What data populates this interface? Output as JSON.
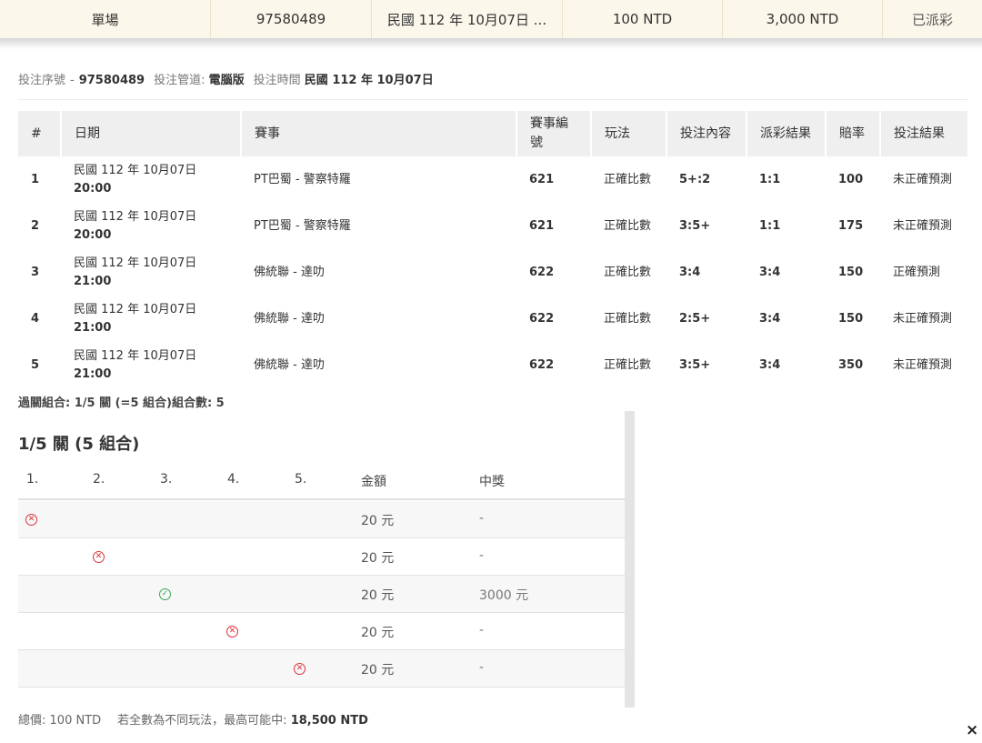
{
  "summary_row": {
    "type": "單場",
    "serial": "97580489",
    "date": "民國 112 年 10月07日 ...",
    "stake": "100 NTD",
    "payout": "3,000 NTD",
    "status": "已派彩"
  },
  "info": {
    "serial_label": "投注序號",
    "serial_value": "97580489",
    "channel_label": "投注管道:",
    "channel_value": "電腦版",
    "time_label": "投注時間",
    "time_value": "民國 112 年 10月07日"
  },
  "table": {
    "headers": [
      "#",
      "日期",
      "賽事",
      "賽事編號",
      "玩法",
      "投注內容",
      "派彩結果",
      "賠率",
      "投注結果"
    ],
    "rows": [
      {
        "no": "1",
        "date": "民國 112 年 10月07日",
        "time": "20:00",
        "event": "PT巴蜀 - 警察特羅",
        "event_no": "621",
        "play": "正確比數",
        "bet": "5+:2",
        "result": "1:1",
        "odds": "100",
        "outcome": "未正確預測"
      },
      {
        "no": "2",
        "date": "民國 112 年 10月07日",
        "time": "20:00",
        "event": "PT巴蜀 - 警察特羅",
        "event_no": "621",
        "play": "正確比數",
        "bet": "3:5+",
        "result": "1:1",
        "odds": "175",
        "outcome": "未正確預測"
      },
      {
        "no": "3",
        "date": "民國 112 年 10月07日",
        "time": "21:00",
        "event": "佛統聯 - 達叻",
        "event_no": "622",
        "play": "正確比數",
        "bet": "3:4",
        "result": "3:4",
        "odds": "150",
        "outcome": "正確預測"
      },
      {
        "no": "4",
        "date": "民國 112 年 10月07日",
        "time": "21:00",
        "event": "佛統聯 - 達叻",
        "event_no": "622",
        "play": "正確比數",
        "bet": "2:5+",
        "result": "3:4",
        "odds": "150",
        "outcome": "未正確預測"
      },
      {
        "no": "5",
        "date": "民國 112 年 10月07日",
        "time": "21:00",
        "event": "佛統聯 - 達叻",
        "event_no": "622",
        "play": "正確比數",
        "bet": "3:5+",
        "result": "3:4",
        "odds": "350",
        "outcome": "未正確預測"
      }
    ]
  },
  "combo_summary": "過關組合: 1/5 關 (=5 組合)組合數: 5",
  "combo": {
    "title": "1/5 關 (5 組合)",
    "headers": [
      "1.",
      "2.",
      "3.",
      "4.",
      "5.",
      "金額",
      "中獎"
    ],
    "rows": [
      {
        "leg": 1,
        "mark": "lose",
        "amount": "20 元",
        "prize": "-"
      },
      {
        "leg": 2,
        "mark": "lose",
        "amount": "20 元",
        "prize": "-"
      },
      {
        "leg": 3,
        "mark": "win",
        "amount": "20 元",
        "prize": "3000 元"
      },
      {
        "leg": 4,
        "mark": "lose",
        "amount": "20 元",
        "prize": "-"
      },
      {
        "leg": 5,
        "mark": "lose",
        "amount": "20 元",
        "prize": "-"
      }
    ]
  },
  "footer": {
    "total_label": "總價:",
    "total_value": "100 NTD",
    "max_label": "若全數為不同玩法，最高可能中:",
    "max_value": "18,500 NTD"
  },
  "close_icon": "×",
  "colors": {
    "lose": "#d9323a",
    "win": "#3aa757",
    "header_bg": "#fbf7ea"
  }
}
